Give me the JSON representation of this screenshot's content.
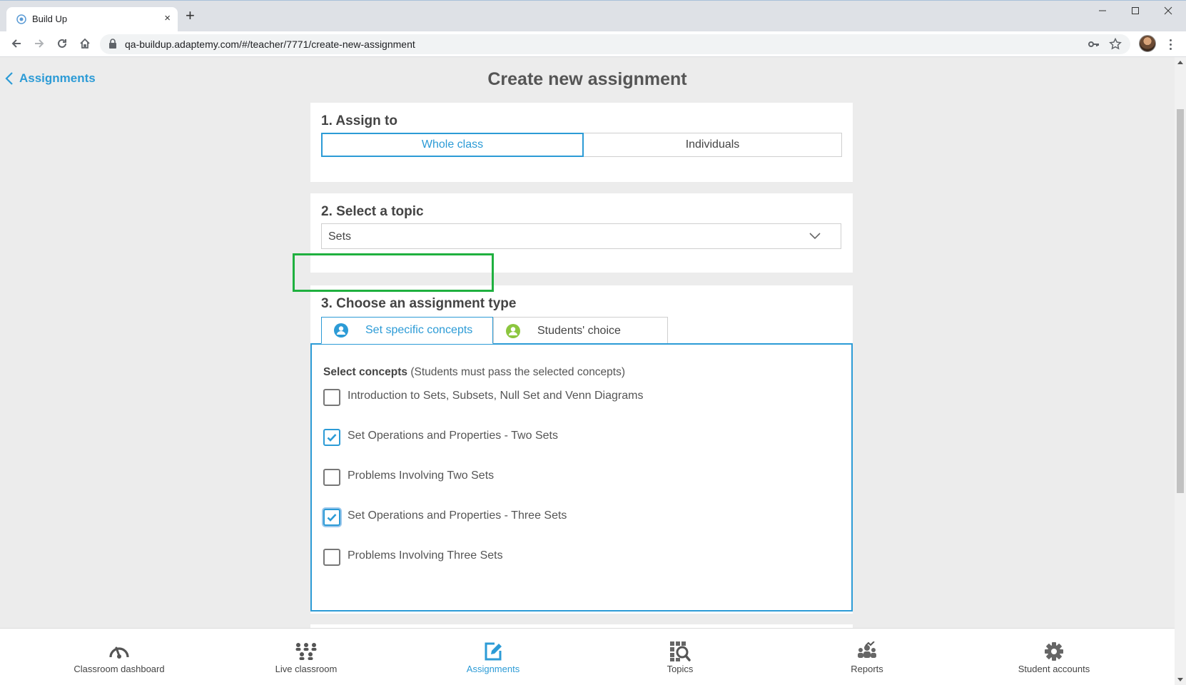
{
  "browser": {
    "tab_title": "Build Up",
    "tab_close": "×",
    "new_tab": "+",
    "url": "qa-buildup.adaptemy.com/#/teacher/7771/create-new-assignment",
    "window_controls": [
      "minimize-icon",
      "maximize-icon",
      "close-icon"
    ]
  },
  "header": {
    "back_label": "Assignments",
    "title": "Create new assignment"
  },
  "assign_to": {
    "heading": "1. Assign to",
    "options": [
      "Whole class",
      "Individuals"
    ],
    "selected": "Whole class"
  },
  "topic": {
    "heading": "2. Select a topic",
    "value": "Sets"
  },
  "assignment_type": {
    "heading": "3. Choose an assignment type",
    "tabs": [
      "Set specific concepts",
      "Students' choice"
    ],
    "active_tab": "Set specific concepts",
    "concepts_intro_bold": "Select concepts",
    "concepts_intro_rest": " (Students must pass the selected concepts)",
    "concepts": [
      {
        "label": "Introduction to Sets, Subsets, Null Set and Venn Diagrams",
        "checked": false
      },
      {
        "label": "Set Operations and Properties - Two Sets",
        "checked": true
      },
      {
        "label": "Problems Involving Two Sets",
        "checked": false
      },
      {
        "label": "Set Operations and Properties - Three Sets",
        "checked": true
      },
      {
        "label": "Problems Involving Three Sets",
        "checked": false
      }
    ]
  },
  "bottom_nav": {
    "items": [
      {
        "label": "Classroom dashboard",
        "icon": "gauge-icon"
      },
      {
        "label": "Live classroom",
        "icon": "group-icon"
      },
      {
        "label": "Assignments",
        "icon": "edit-icon"
      },
      {
        "label": "Topics",
        "icon": "topics-icon"
      },
      {
        "label": "Reports",
        "icon": "reports-icon"
      },
      {
        "label": "Student accounts",
        "icon": "gear-icon"
      }
    ],
    "active": "Assignments"
  },
  "colors": {
    "accent": "#2c9bd6",
    "highlight": "#1fb03f",
    "students_choice_icon": "#8cc63f"
  }
}
